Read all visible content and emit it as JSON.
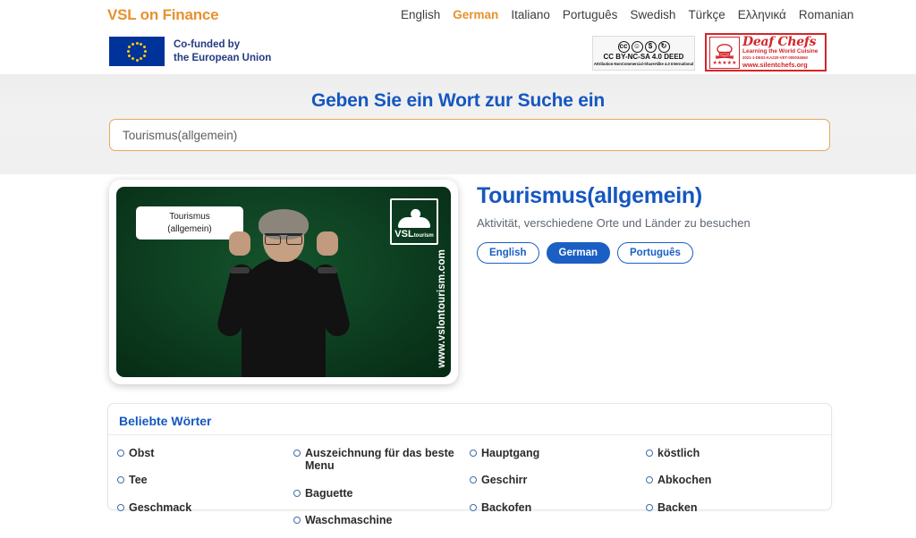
{
  "header": {
    "brand": "VSL on Finance",
    "languages": [
      {
        "label": "English",
        "active": false
      },
      {
        "label": "German",
        "active": true
      },
      {
        "label": "Italiano",
        "active": false
      },
      {
        "label": "Português",
        "active": false
      },
      {
        "label": "Swedish",
        "active": false
      },
      {
        "label": "Türkçe",
        "active": false
      },
      {
        "label": "Ελληνικά",
        "active": false
      },
      {
        "label": "Romanian",
        "active": false
      }
    ],
    "eu_logo": {
      "line1": "Co-funded by",
      "line2": "the European Union"
    },
    "cc_badge": {
      "icons": [
        "cc",
        "by",
        "nc",
        "sa"
      ],
      "title": "CC BY-NC-SA 4.0 DEED",
      "subtitle": "Attribution-NonCommercial-ShareAlike 4.0 International"
    },
    "chefs_badge": {
      "title": "Deaf Chefs",
      "subtitle": "Learning the World Cuisine",
      "code": "2021-1-DE02-KA220-VET-000034650",
      "url": "www.silentchefs.org"
    }
  },
  "search": {
    "heading": "Geben Sie ein Wort zur Suche ein",
    "value": "Tourismus(allgemein)",
    "placeholder": "Geben Sie ein Wort zur Suche ein"
  },
  "result": {
    "video": {
      "caption_line1": "Tourismus",
      "caption_line2": "(allgemein)",
      "logo_text": "VSL",
      "logo_sub": "tourism",
      "watermark_url": "www.vslontourism.com"
    },
    "title": "Tourismus(allgemein)",
    "description": "Aktivität, verschiedene Orte und Länder zu besuchen",
    "language_pills": [
      {
        "label": "English",
        "active": false
      },
      {
        "label": "German",
        "active": true
      },
      {
        "label": "Português",
        "active": false
      }
    ]
  },
  "popular": {
    "heading": "Beliebte Wörter",
    "columns": [
      [
        "Obst",
        "Tee",
        "Geschmack"
      ],
      [
        "Auszeichnung für das beste Menu",
        "Baguette",
        "Waschmaschine"
      ],
      [
        "Hauptgang",
        "Geschirr",
        "Backofen"
      ],
      [
        "köstlich",
        "Abkochen",
        "Backen"
      ]
    ]
  },
  "colors": {
    "brand_orange": "#e8912d",
    "heading_blue": "#1557c0",
    "pill_blue": "#1b5fc4",
    "band_gray": "#f1f1f1",
    "video_green": "#0d3d20",
    "chefs_red": "#d4252a",
    "eu_blue": "#003399"
  }
}
